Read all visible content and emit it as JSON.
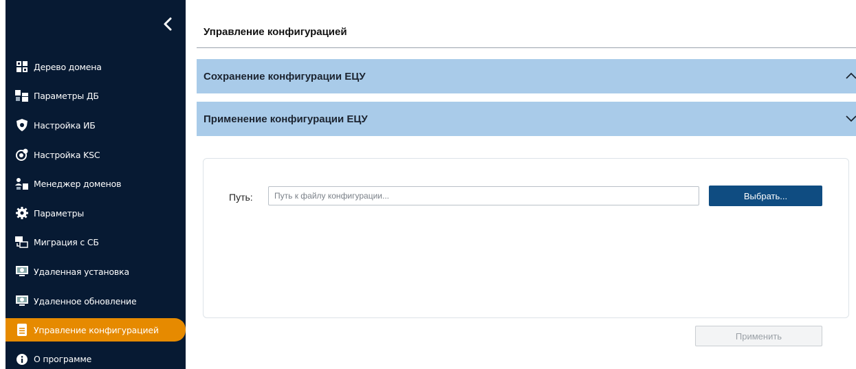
{
  "sidebar": {
    "collapse_icon": "chevron-left-icon",
    "items": [
      {
        "label": "Дерево домена",
        "icon": "domain-tree-icon"
      },
      {
        "label": "Параметры ДБ",
        "icon": "db-params-icon"
      },
      {
        "label": "Настройка ИБ",
        "icon": "shield-icon"
      },
      {
        "label": "Настройка KSC",
        "icon": "ksc-gear-icon"
      },
      {
        "label": "Менеджер доменов",
        "icon": "domain-manager-icon"
      },
      {
        "label": "Параметры",
        "icon": "gear-icon"
      },
      {
        "label": "Миграция с СБ",
        "icon": "migration-icon"
      },
      {
        "label": "Удаленная установка",
        "icon": "remote-install-icon"
      },
      {
        "label": "Удаленное обновление",
        "icon": "remote-update-icon"
      },
      {
        "label": "Управление конфигурацией",
        "icon": "config-icon",
        "active": true
      },
      {
        "label": "О программе",
        "icon": "info-icon"
      }
    ]
  },
  "main": {
    "title": "Управление конфигурацией",
    "sections": [
      {
        "title": "Сохранение конфигурации ЕЦУ",
        "expanded": false,
        "icon": "chevron-up-icon"
      },
      {
        "title": "Применение конфигурации ЕЦУ",
        "expanded": true,
        "icon": "chevron-down-icon"
      }
    ],
    "path_label": "Путь:",
    "path_value": "",
    "path_placeholder": "Путь к файлу конфигурации...",
    "choose_label": "Выбрать...",
    "apply_label": "Применить"
  },
  "colors": {
    "sidebar_bg": "#071a33",
    "active_item": "#e68a00",
    "accordion_bg": "#a9cbe9",
    "primary_button": "#0f4c81"
  }
}
